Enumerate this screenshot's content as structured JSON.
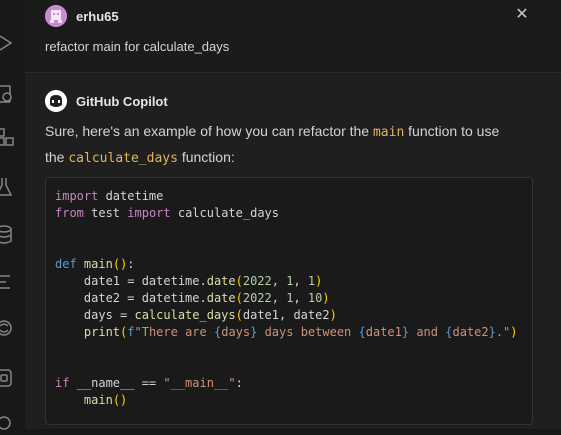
{
  "request": {
    "user_name": "erhu65",
    "message": "refactor main for calculate_days"
  },
  "response": {
    "bot_name": "GitHub Copilot",
    "text_before": "Sure, here's an example of how you can refactor the ",
    "code_main": "main",
    "text_middle": " function to use the ",
    "code_calculate": "calculate_days",
    "text_after": " function:"
  },
  "code": {
    "lines": [
      "import datetime",
      "from test import calculate_days",
      "",
      "",
      "def main():",
      "    date1 = datetime.date(2022, 1, 1)",
      "    date2 = datetime.date(2022, 1, 10)",
      "    days = calculate_days(date1, date2)",
      "    print(f\"There are {days} days between {date1} and {date2}.\")",
      "",
      "",
      "if __name__ == \"__main__\":",
      "    main()"
    ]
  },
  "icons": {
    "close": "close-icon",
    "activity": [
      "run-debug-icon",
      "remote-explorer-icon",
      "extensions-icon",
      "testing-icon",
      "database-icon",
      "outline-icon",
      "copilot-chat-icon",
      "docker-icon",
      "accounts-icon"
    ]
  },
  "colors": {
    "background": "#1f1f1f",
    "keyword": "#c586c0",
    "string": "#ce9178",
    "number": "#b5cea8",
    "function": "#dcdcaa",
    "inline_code": "#e0b85a"
  }
}
